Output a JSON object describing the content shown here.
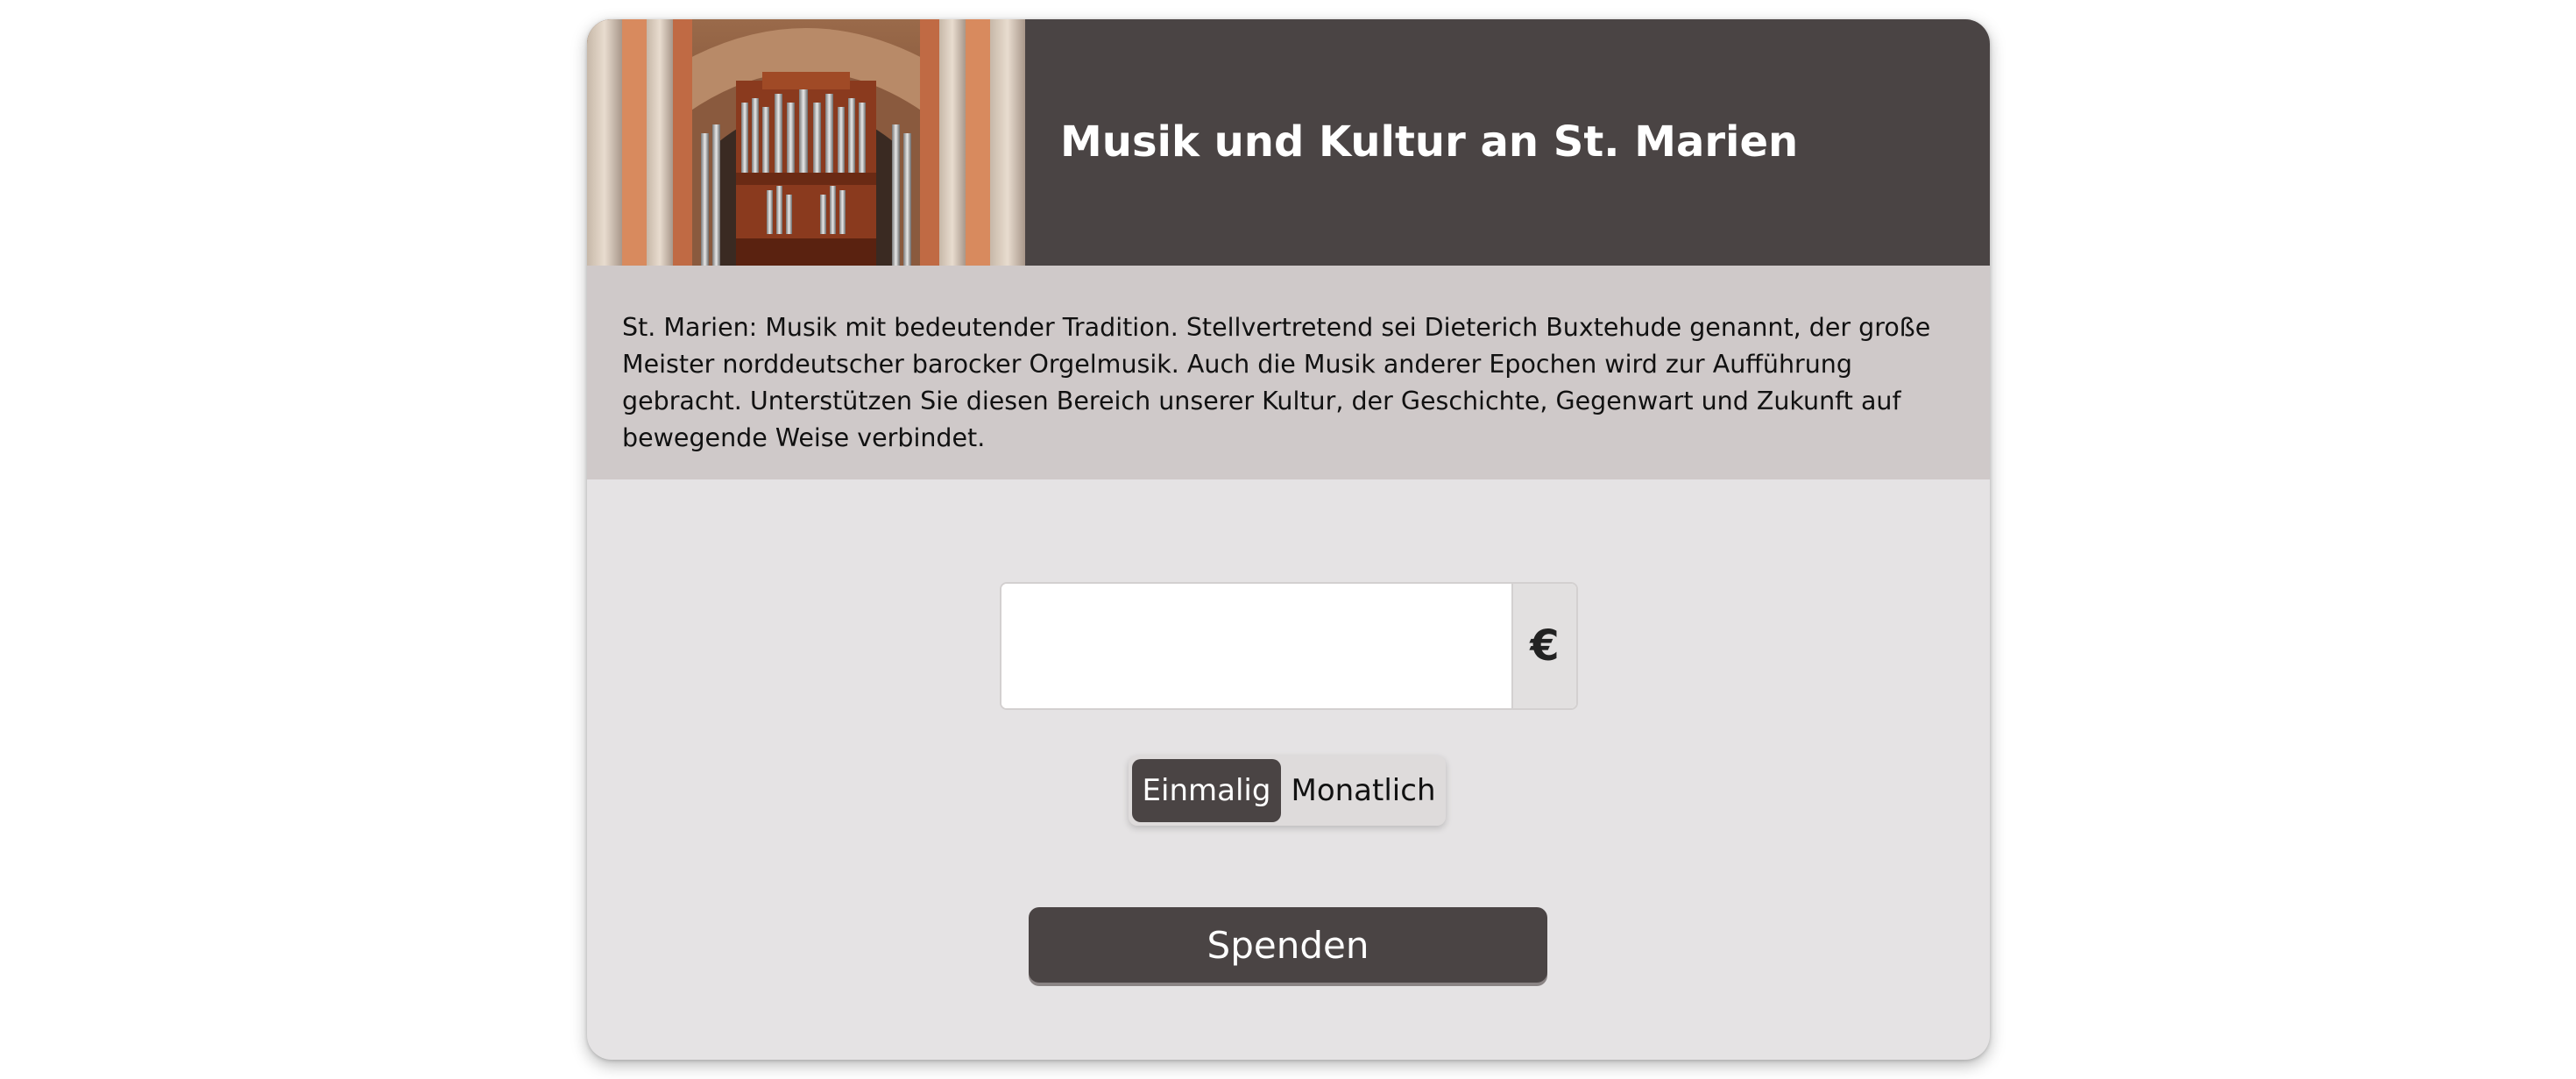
{
  "header": {
    "title": "Musik und Kultur an St. Marien",
    "image_alt": "church-organ-photo"
  },
  "description": {
    "text": "St. Marien: Musik mit bedeutender Tradition. Stellvertretend sei Dieterich Buxtehude genannt, der große Meister norddeutscher barocker Orgelmusik. Auch die Musik anderer Epochen wird zur Aufführung gebracht. Unterstützen Sie diesen Bereich unserer Kultur, der Geschichte, Gegenwart und Zukunft auf bewegende Weise verbindet."
  },
  "donation": {
    "amount_value": "",
    "currency_symbol": "€",
    "frequency_options": [
      {
        "label": "Einmalig",
        "selected": true
      },
      {
        "label": "Monatlich",
        "selected": false
      }
    ],
    "submit_label": "Spenden"
  },
  "colors": {
    "header_bg": "#4a4444",
    "description_bg": "#cfc9c9",
    "form_bg": "#e5e3e4",
    "accent": "#4a4444"
  }
}
